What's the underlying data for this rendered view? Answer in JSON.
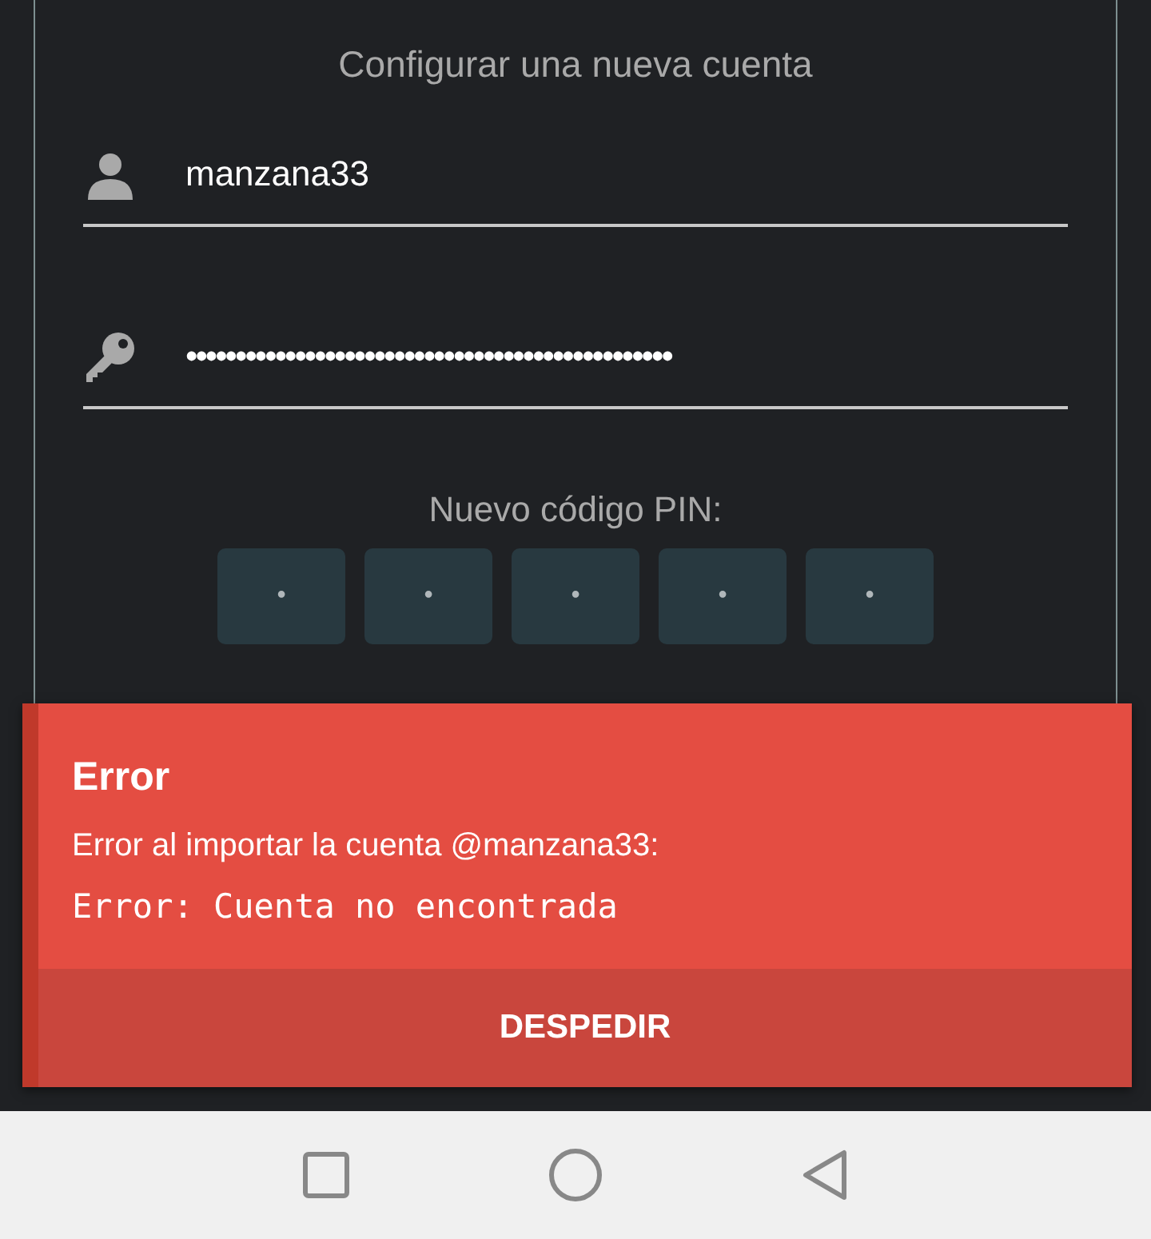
{
  "form": {
    "title": "Configurar una nueva cuenta",
    "username": {
      "value": "manzana33"
    },
    "password": {
      "value": "•••••••••••••••••••••••••••••••••••••••••••••••••"
    },
    "pin": {
      "label": "Nuevo código PIN:",
      "digits": [
        "•",
        "•",
        "•",
        "•",
        "•"
      ]
    }
  },
  "error": {
    "title": "Error",
    "message": "Error al importar la cuenta @manzana33:",
    "detail": "Error: Cuenta no encontrada",
    "button": "DESPEDIR"
  },
  "nav_bar": {
    "buttons": [
      {
        "kind": "recents"
      },
      {
        "kind": "home"
      },
      {
        "kind": "back"
      }
    ]
  }
}
